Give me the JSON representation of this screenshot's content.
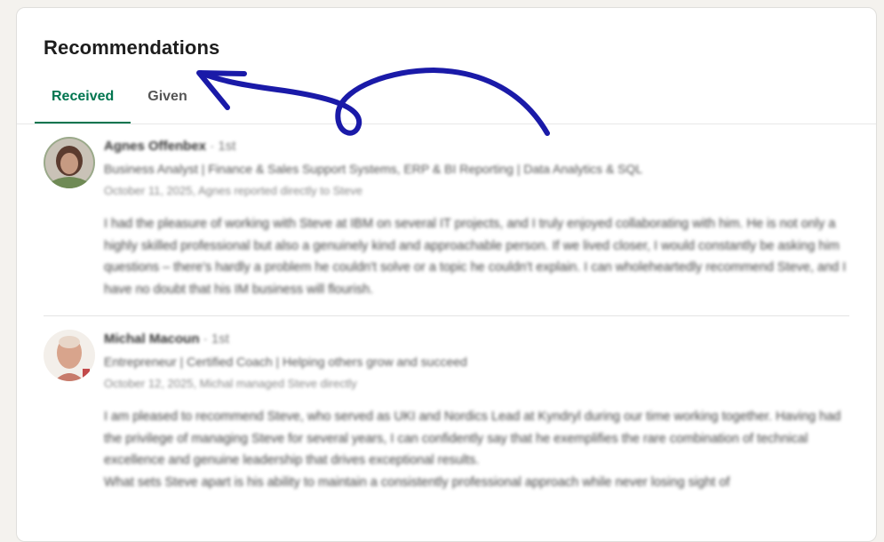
{
  "section": {
    "title": "Recommendations",
    "tabs": [
      {
        "label": "Received",
        "active": true
      },
      {
        "label": "Given",
        "active": false
      }
    ]
  },
  "recommendations": [
    {
      "name": "Agnes Offenbex",
      "degree": "· 1st",
      "headline": "Business Analyst | Finance & Sales Support Systems, ERP & BI Reporting | Data Analytics & SQL",
      "meta": "October 11, 2025, Agnes reported directly to Steve",
      "text": "I had the pleasure of working with Steve at IBM on several IT projects, and I truly enjoyed collaborating with him. He is not only a highly skilled professional but also a genuinely kind and approachable person. If we lived closer, I would constantly be asking him questions – there's hardly a problem he couldn't solve or a topic he couldn't explain. I can wholeheartedly recommend Steve, and I have no doubt that his IM business will flourish."
    },
    {
      "name": "Michal Macoun",
      "degree": "· 1st",
      "headline": "Entrepreneur | Certified Coach | Helping others grow and succeed",
      "meta": "October 12, 2025, Michal managed Steve directly",
      "text": "I am pleased to recommend Steve, who served as UKI and Nordics Lead at Kyndryl during our time working together. Having had the privilege of managing Steve for several years, I can confidently say that he exemplifies the rare combination of technical excellence and genuine leadership that drives exceptional results.",
      "text2": "What sets Steve apart is his ability to maintain a consistently professional approach while never losing sight of"
    }
  ],
  "colors": {
    "accent": "#01754f",
    "annotation_arrow": "#1a1aa8"
  }
}
